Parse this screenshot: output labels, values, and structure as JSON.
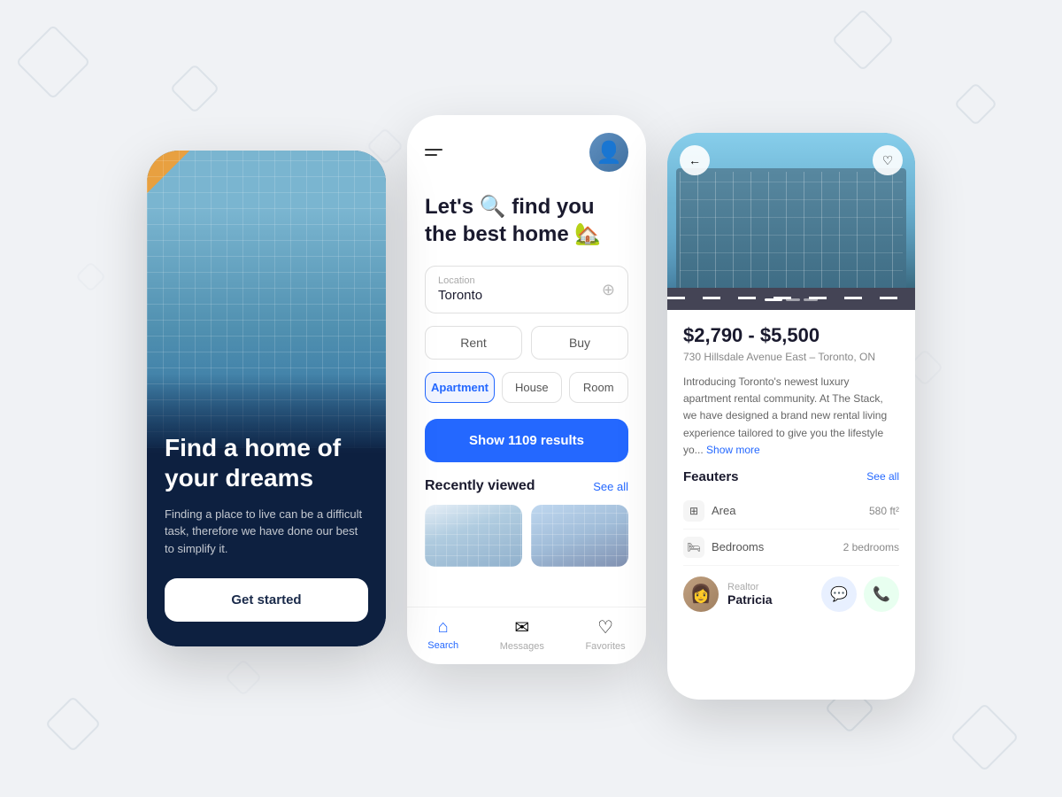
{
  "background": {
    "color": "#f0f2f5"
  },
  "screen1": {
    "title": "Find a home of your dreams",
    "subtitle": "Finding a place to live can be a difficult task, therefore we have done our best to simplify it.",
    "cta_label": "Get started"
  },
  "screen2": {
    "header": {
      "menu_icon": "≡",
      "avatar_emoji": "👤"
    },
    "heading_line1": "Let's 🔍 find you",
    "heading_line2": "the best home 🏡",
    "location": {
      "label": "Location",
      "value": "Toronto",
      "icon": "⊕"
    },
    "transaction_types": [
      {
        "label": "Rent",
        "active": false
      },
      {
        "label": "Buy",
        "active": false
      }
    ],
    "property_types": [
      {
        "label": "Apartment",
        "active": true
      },
      {
        "label": "House",
        "active": false
      },
      {
        "label": "Room",
        "active": false
      }
    ],
    "show_results_btn": "Show 1109 results",
    "recently_viewed": {
      "title": "Recently viewed",
      "see_all": "See all"
    },
    "nav": [
      {
        "label": "Search",
        "active": true,
        "icon": "⌂"
      },
      {
        "label": "Messages",
        "active": false,
        "icon": "✉"
      },
      {
        "label": "Favorites",
        "active": false,
        "icon": "♡"
      }
    ]
  },
  "screen3": {
    "price_range": "$2,790 - $5,500",
    "address": "730 Hillsdale Avenue East – Toronto, ON",
    "description": "Introducing Toronto's newest luxury apartment rental community. At The Stack, we have designed a brand new rental living experience tailored to give you the lifestyle yo...",
    "show_more": "Show more",
    "features": {
      "title": "Feauters",
      "see_all": "See all",
      "items": [
        {
          "icon": "⊞",
          "label": "Area",
          "value": "580 ft²"
        },
        {
          "icon": "🛏",
          "label": "Bedrooms",
          "value": "2 bedrooms"
        }
      ]
    },
    "realtor": {
      "role": "Realtor",
      "name": "Patricia",
      "avatar": "👩"
    },
    "nav": {
      "back": "←",
      "heart": "♡"
    },
    "dots": [
      true,
      false,
      false
    ]
  }
}
